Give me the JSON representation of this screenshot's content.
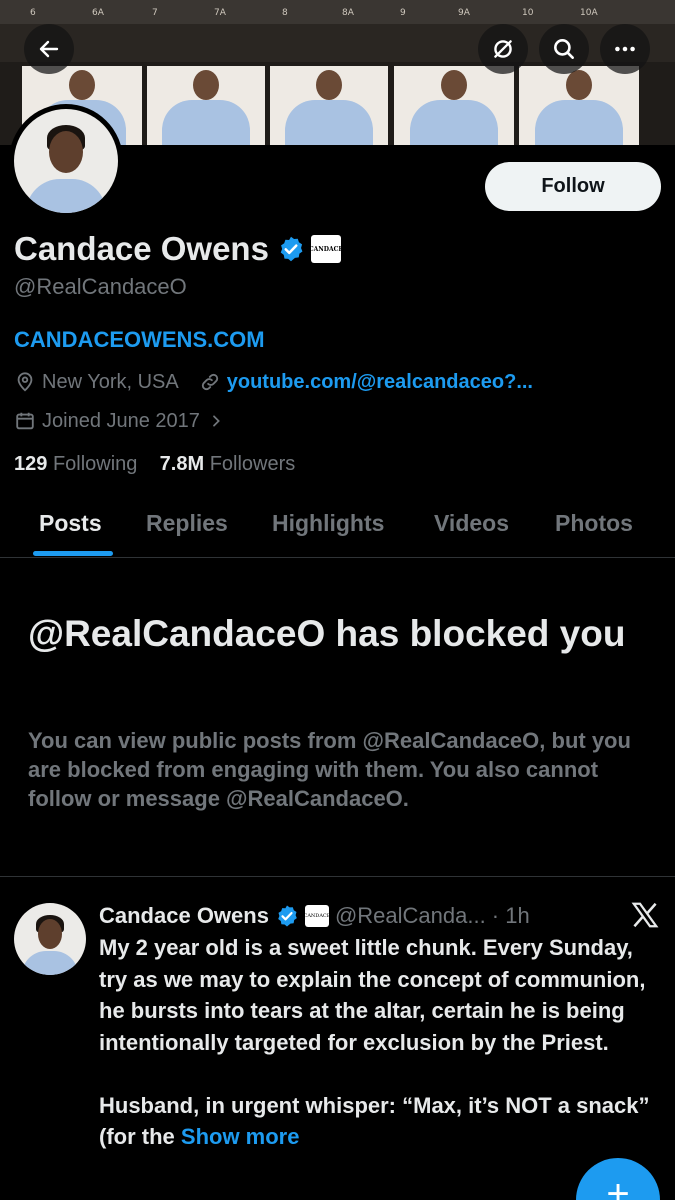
{
  "banner": {
    "film_marks": [
      "6",
      "6A",
      "7",
      "7A",
      "8",
      "8A",
      "9",
      "9A",
      "10",
      "10A"
    ]
  },
  "top_bar": {
    "back_icon": "arrow-left-icon",
    "buttons": [
      "sync-icon",
      "search-icon",
      "more-icon"
    ]
  },
  "profile": {
    "follow_label": "Follow",
    "name": "Candace Owens",
    "affiliation_badge": "CANDACE",
    "handle": "@RealCandaceO",
    "website": "CANDACEOWENS.COM",
    "location": "New York, USA",
    "link": "youtube.com/@realcandaceo?...",
    "joined": "Joined June 2017",
    "following_count": "129",
    "following_label": "Following",
    "followers_count": "7.8M",
    "followers_label": "Followers"
  },
  "tabs": [
    "Posts",
    "Replies",
    "Highlights",
    "Videos",
    "Photos"
  ],
  "blocked": {
    "title": "@RealCandaceO has blocked you",
    "description": "You can view public posts from @RealCandaceO, but you are blocked from engaging with them. You also cannot follow or message @RealCandaceO."
  },
  "post": {
    "name": "Candace Owens",
    "handle_time": "@RealCanda... · 1h",
    "paragraph1": "My 2 year old is a sweet little chunk. Every Sunday, try as we may to explain the concept of communion, he bursts into tears at the altar, certain he is being intentionally targeted for exclusion by the Priest.",
    "paragraph2": "Husband, in urgent whisper: “Max, it’s NOT a snack” (for the",
    "show_more": "Show more"
  },
  "colors": {
    "accent": "#1d9bf0",
    "background": "#000000",
    "secondary_text": "#71767b",
    "follow_button": "#eff3f4"
  }
}
